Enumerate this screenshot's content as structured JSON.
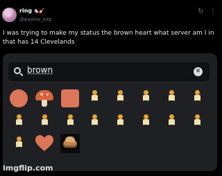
{
  "post": {
    "display_name": "ring",
    "name_emojis": "🐁🎸",
    "handle": "@pavlov_exp",
    "text": "I was trying to make my status the brown heart what server am I in that has 14 Clevelands"
  },
  "header_icons": {
    "refresh": "refresh-icon",
    "more": "more-options-icon",
    "refresh_glyph": "↻",
    "more_glyph": "⋮"
  },
  "search": {
    "value": "brown",
    "search_icon": "search-icon",
    "clear_icon": "clear-icon",
    "clear_glyph": "✕"
  },
  "emoji_results": [
    {
      "name": "brown-circle-emoji"
    },
    {
      "name": "brown-mushroom-emoji"
    },
    {
      "name": "brown-square-emoji"
    },
    {
      "name": "cleveland-emoji"
    },
    {
      "name": "cleveland-emoji"
    },
    {
      "name": "cleveland-emoji"
    },
    {
      "name": "cleveland-emoji"
    },
    {
      "name": "cleveland-emoji"
    },
    {
      "name": "cleveland-emoji"
    },
    {
      "name": "cleveland-emoji"
    },
    {
      "name": "cleveland-emoji"
    },
    {
      "name": "cleveland-emoji"
    },
    {
      "name": "cleveland-emoji"
    },
    {
      "name": "cleveland-emoji"
    },
    {
      "name": "cleveland-emoji"
    },
    {
      "name": "cleveland-emoji"
    },
    {
      "name": "cleveland-emoji"
    },
    {
      "name": "brown-heart-emoji"
    },
    {
      "name": "bread-emoji"
    }
  ],
  "colors": {
    "brown": "#dd7559",
    "panel": "#1f2023",
    "background": "#000000"
  },
  "watermark": "imgflip.com"
}
